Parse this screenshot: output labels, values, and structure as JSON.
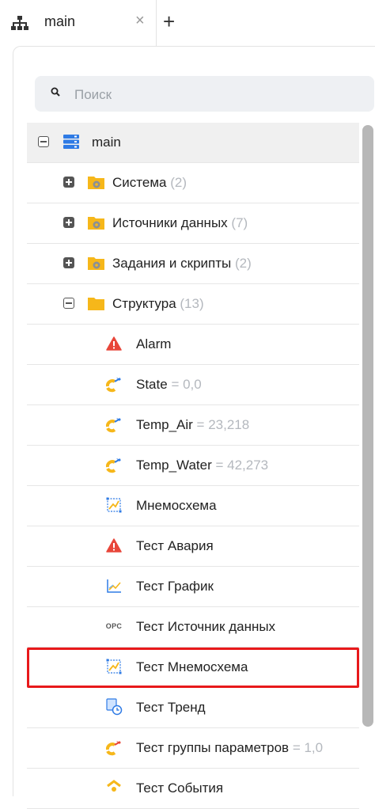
{
  "tab": {
    "label": "main",
    "close": "×",
    "add": "+"
  },
  "search": {
    "placeholder": "Поиск"
  },
  "tree": {
    "root": {
      "label": "main"
    },
    "folders": [
      {
        "label": "Система",
        "count": "(2)"
      },
      {
        "label": "Источники данных",
        "count": "(7)"
      },
      {
        "label": "Задания и скрипты",
        "count": "(2)"
      },
      {
        "label": "Структура",
        "count": "(13)"
      }
    ],
    "items": [
      {
        "label": "Alarm",
        "value": "",
        "icon": "alarm-icon"
      },
      {
        "label": "State",
        "value": "= 0,0",
        "icon": "parameter-icon"
      },
      {
        "label": "Temp_Air",
        "value": "= 23,218",
        "icon": "parameter-icon"
      },
      {
        "label": "Temp_Water",
        "value": "= 42,273",
        "icon": "parameter-icon"
      },
      {
        "label": "Мнемосхема",
        "value": "",
        "icon": "mnemoscheme-icon"
      },
      {
        "label": "Тест Авария",
        "value": "",
        "icon": "alarm-icon"
      },
      {
        "label": "Тест График",
        "value": "",
        "icon": "chart-icon"
      },
      {
        "label": "Тест Источник данных",
        "value": "",
        "icon": "opc-icon",
        "icon_text": "OPC"
      },
      {
        "label": "Тест Мнемосхема",
        "value": "",
        "icon": "mnemoscheme-icon"
      },
      {
        "label": "Тест Тренд",
        "value": "",
        "icon": "trend-icon"
      },
      {
        "label": "Тест группы параметров",
        "value": "= 1,0",
        "icon": "parameter-group-icon"
      },
      {
        "label": "Тест События",
        "value": "",
        "icon": "events-icon"
      }
    ]
  },
  "colors": {
    "accent_blue": "#2f7be5",
    "folder_yellow": "#f6b71a",
    "alarm_red": "#e8463a",
    "selection_red": "#e8191b"
  }
}
